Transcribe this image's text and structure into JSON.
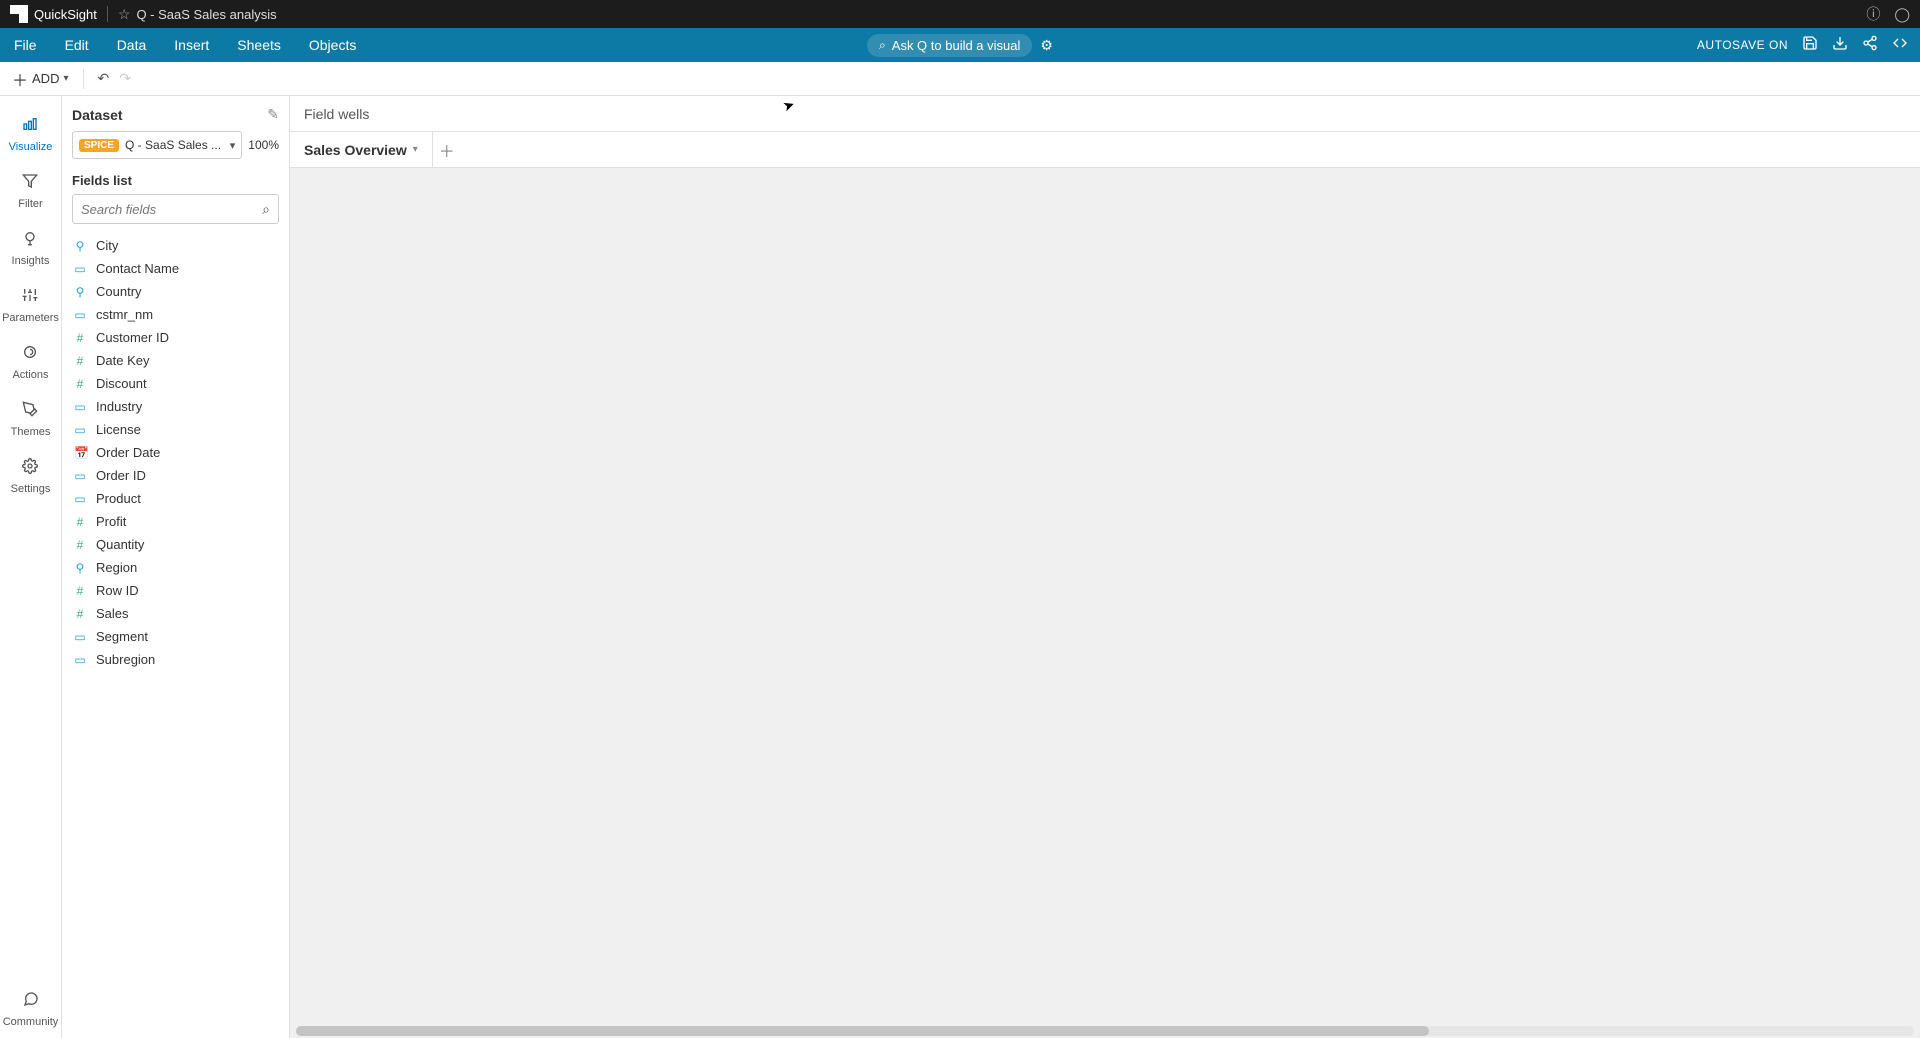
{
  "topbar": {
    "app_name": "QuickSight",
    "analysis_title": "Q - SaaS Sales analysis"
  },
  "menubar": {
    "items": [
      "File",
      "Edit",
      "Data",
      "Insert",
      "Sheets",
      "Objects"
    ],
    "ask_q_label": "Ask Q to build a visual",
    "autosave_label": "AUTOSAVE ON"
  },
  "toolbar": {
    "add_label": "ADD"
  },
  "rail": {
    "items": [
      {
        "label": "Visualize",
        "active": true
      },
      {
        "label": "Filter",
        "active": false
      },
      {
        "label": "Insights",
        "active": false
      },
      {
        "label": "Parameters",
        "active": false
      },
      {
        "label": "Actions",
        "active": false
      },
      {
        "label": "Themes",
        "active": false
      },
      {
        "label": "Settings",
        "active": false
      }
    ],
    "community_label": "Community"
  },
  "panel": {
    "dataset_title": "Dataset",
    "spice_badge": "SPICE",
    "dataset_name": "Q - SaaS Sales ...",
    "dataset_pct": "100%",
    "fields_title": "Fields list",
    "search_placeholder": "Search fields",
    "fields": [
      {
        "name": "City",
        "type": "geo"
      },
      {
        "name": "Contact Name",
        "type": "str"
      },
      {
        "name": "Country",
        "type": "geo"
      },
      {
        "name": "cstmr_nm",
        "type": "str"
      },
      {
        "name": "Customer ID",
        "type": "num"
      },
      {
        "name": "Date Key",
        "type": "num"
      },
      {
        "name": "Discount",
        "type": "num"
      },
      {
        "name": "Industry",
        "type": "str"
      },
      {
        "name": "License",
        "type": "str"
      },
      {
        "name": "Order Date",
        "type": "date"
      },
      {
        "name": "Order ID",
        "type": "str"
      },
      {
        "name": "Product",
        "type": "str"
      },
      {
        "name": "Profit",
        "type": "num"
      },
      {
        "name": "Quantity",
        "type": "num"
      },
      {
        "name": "Region",
        "type": "geo"
      },
      {
        "name": "Row ID",
        "type": "num"
      },
      {
        "name": "Sales",
        "type": "num"
      },
      {
        "name": "Segment",
        "type": "str"
      },
      {
        "name": "Subregion",
        "type": "str"
      }
    ]
  },
  "canvas": {
    "fieldwells_label": "Field wells",
    "tabs": [
      {
        "label": "Sales Overview"
      }
    ]
  }
}
